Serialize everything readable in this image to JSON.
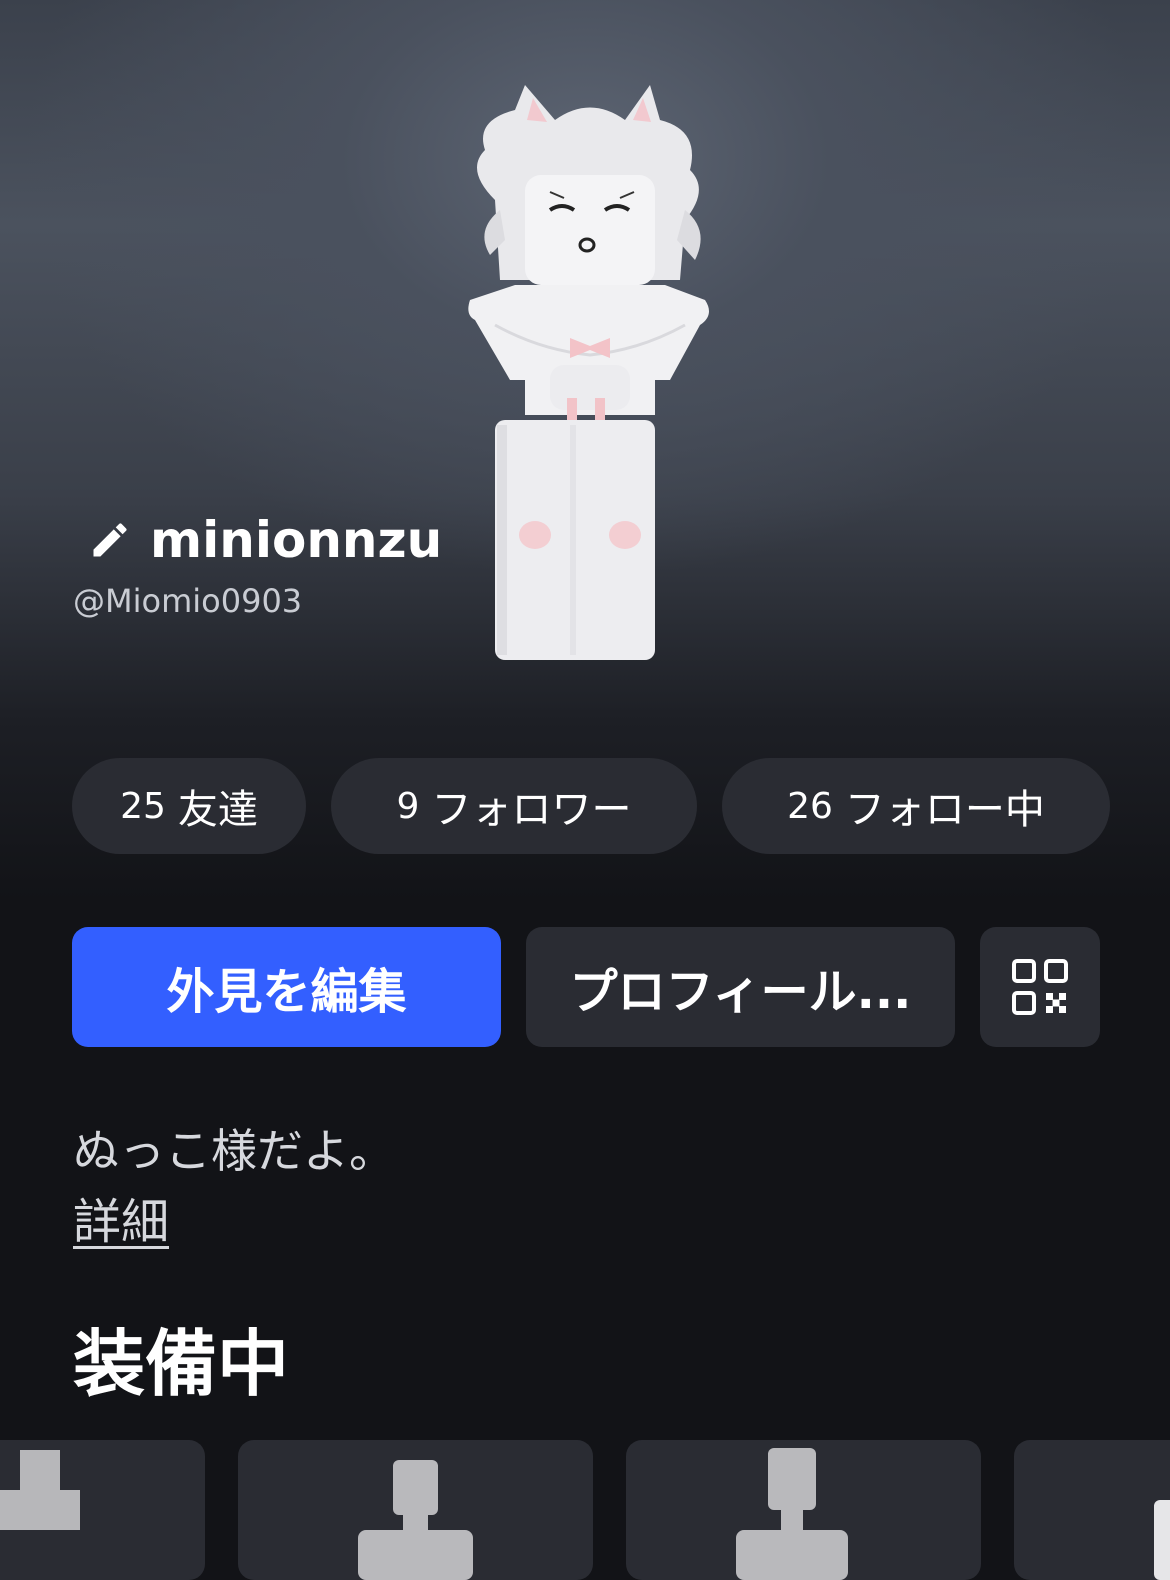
{
  "profile": {
    "display_name": "minionnzu",
    "username": "@Miomio0903"
  },
  "stats": [
    {
      "count": "25",
      "label": "友達"
    },
    {
      "count": "9",
      "label": "フォロワー"
    },
    {
      "count": "26",
      "label": "フォロー中"
    }
  ],
  "actions": {
    "edit_avatar": "外見を編集",
    "profile": "プロフィール..."
  },
  "about": {
    "bio": "ぬっこ様だよ。",
    "more_link": "詳細"
  },
  "equipped": {
    "title": "装備中"
  },
  "icons": {
    "edit": "pencil-icon",
    "qr": "qr-code-icon"
  },
  "colors": {
    "primary": "#335fff",
    "pill_bg": "#2a2c33",
    "background": "#121317"
  }
}
